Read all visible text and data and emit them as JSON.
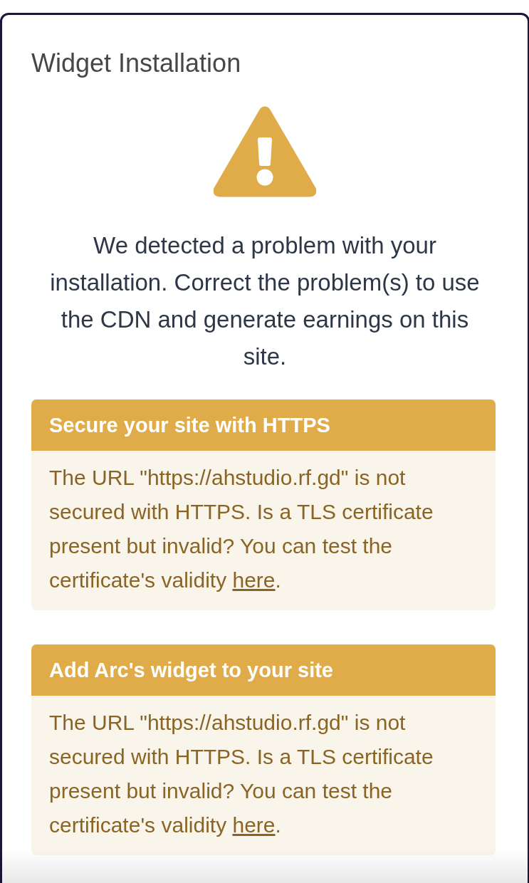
{
  "card": {
    "title": "Widget Installation",
    "message": "We detected a problem with your installation. Correct the problem(s) to use the CDN and generate earnings on this site.",
    "alerts": [
      {
        "title": "Secure your site with HTTPS",
        "text_before": "The URL \"https://ahstudio.rf.gd\" is not secured with HTTPS. Is a TLS certificate present but invalid? You can test the certificate's validity ",
        "link": "here",
        "text_after": "."
      },
      {
        "title": "Add Arc's widget to your site",
        "text_before": "The URL \"https://ahstudio.rf.gd\" is not secured with HTTPS. Is a TLS certificate present but invalid? You can test the certificate's validity ",
        "link": "here",
        "text_after": "."
      }
    ]
  }
}
